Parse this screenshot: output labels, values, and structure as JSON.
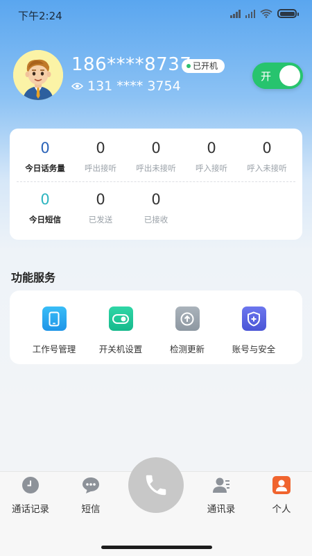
{
  "status_bar": {
    "time": "下午2:24"
  },
  "profile": {
    "phone_number": "186****8737",
    "status_badge": "已开机",
    "sub_number": "131 **** 3754",
    "toggle_label": "开",
    "toggle_on": true
  },
  "stats": {
    "row1": [
      {
        "value": "0",
        "label": "今日话务量"
      },
      {
        "value": "0",
        "label": "呼出接听"
      },
      {
        "value": "0",
        "label": "呼出未接听"
      },
      {
        "value": "0",
        "label": "呼入接听"
      },
      {
        "value": "0",
        "label": "呼入未接听"
      }
    ],
    "row2": [
      {
        "value": "0",
        "label": "今日短信"
      },
      {
        "value": "0",
        "label": "已发送"
      },
      {
        "value": "0",
        "label": "已接收"
      }
    ]
  },
  "services": {
    "title": "功能服务",
    "items": [
      {
        "label": "工作号管理",
        "icon": "phone-icon",
        "color": "#27a8f0"
      },
      {
        "label": "开关机设置",
        "icon": "toggle-icon",
        "color": "#21c498"
      },
      {
        "label": "检测更新",
        "icon": "update-icon",
        "color": "#9aa4ad"
      },
      {
        "label": "账号与安全",
        "icon": "shield-icon",
        "color": "#5b66e0"
      }
    ]
  },
  "nav": {
    "items": [
      {
        "label": "通话记录",
        "icon": "clock-icon"
      },
      {
        "label": "短信",
        "icon": "message-icon"
      },
      {
        "label": "通讯录",
        "icon": "contacts-icon"
      },
      {
        "label": "个人",
        "icon": "person-icon"
      }
    ],
    "active_color": "#f0642e",
    "call_icon": "phone-call-icon"
  }
}
